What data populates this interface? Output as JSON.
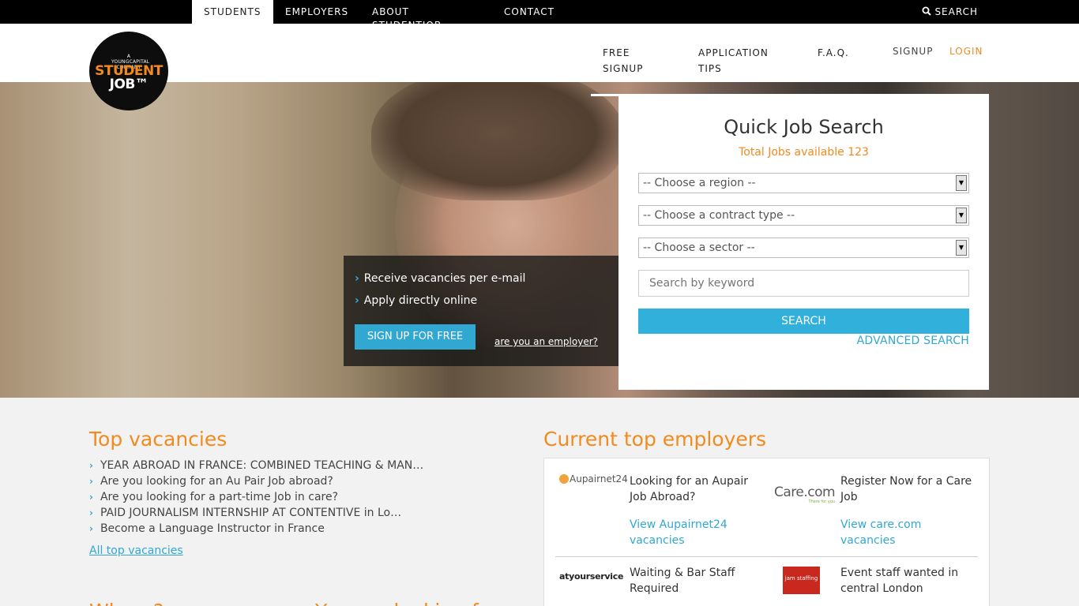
{
  "topnav": {
    "students": "STUDENTS",
    "employers": "EMPLOYERS",
    "about": "ABOUT STUDENTJOB",
    "contact": "CONTACT",
    "search": "SEARCH"
  },
  "logo": {
    "sup": "A YOUNGCAPITAL COMPANY",
    "line1": "STUDENT",
    "line2": "JOB™"
  },
  "mainnav": {
    "free_signup_1": "FREE",
    "free_signup_2": "SIGNUP",
    "tips_1": "APPLICATION",
    "tips_2": "TIPS",
    "faq": "F.A.Q.",
    "signup": "SIGNUP",
    "login": "LOGIN"
  },
  "hero": {
    "items": [
      "Receive vacancies per e-mail",
      "Apply directly online"
    ],
    "signup_button": "SIGN UP FOR FREE",
    "employer_link": "are you an employer?"
  },
  "search": {
    "title": "Quick Job Search",
    "total": "Total Jobs available 123",
    "region": "-- Choose a region --",
    "contract": "-- Choose a contract type --",
    "sector": "-- Choose a sector --",
    "keyword_placeholder": "Search by keyword",
    "button": "SEARCH",
    "advanced": "ADVANCED SEARCH"
  },
  "top_vacancies": {
    "title": "Top vacancies",
    "items": [
      "YEAR ABROAD IN FRANCE: COMBINED TEACHING & MAN…",
      "Are you looking for an Au Pair Job abroad?",
      "Are you looking for a part-time Job in care?",
      "PAID JOURNALISM INTERNSHIP AT CONTENTIVE in Lo…",
      "Become a Language Instructor in France"
    ],
    "all_link": "All top vacancies"
  },
  "employers": {
    "title": "Current top employers",
    "items": [
      {
        "logo": "Aupairnet24",
        "text": "Looking for an Aupair Job Abroad?",
        "link": "View Aupairnet24 vacancies"
      },
      {
        "logo": "Care.com",
        "logo_tag": "There for you",
        "text": "Register Now for a Care Job",
        "link": "View care.com vacancies"
      },
      {
        "logo": "atyourservice",
        "text": "Waiting & Bar Staff Required"
      },
      {
        "logo": "jam staffing",
        "text": "Event staff wanted in central London"
      }
    ]
  },
  "lower_titles": [
    "Where?",
    "You are looking for"
  ],
  "colors": {
    "accent": "#f28a1e",
    "link": "#30a8d2",
    "button": "#30b0da",
    "topbar": "#000000"
  }
}
